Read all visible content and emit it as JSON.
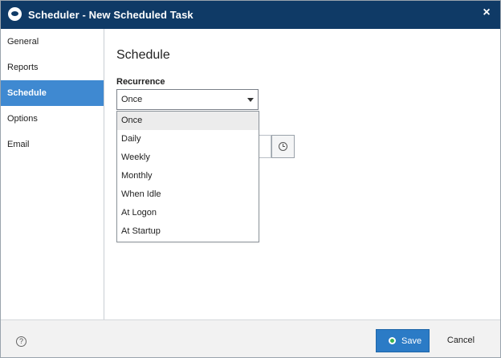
{
  "window": {
    "title": "Scheduler - New Scheduled Task",
    "close_glyph": "×"
  },
  "sidebar": {
    "items": [
      {
        "label": "General"
      },
      {
        "label": "Reports"
      },
      {
        "label": "Schedule"
      },
      {
        "label": "Options"
      },
      {
        "label": "Email"
      }
    ],
    "active_index": 2
  },
  "content": {
    "section_title": "Schedule",
    "recurrence": {
      "label": "Recurrence",
      "selected": "Once",
      "options": [
        "Once",
        "Daily",
        "Weekly",
        "Monthly",
        "When Idle",
        "At Logon",
        "At Startup"
      ],
      "hovered": "Once"
    }
  },
  "footer": {
    "help_glyph": "?",
    "save_label": "Save",
    "cancel_label": "Cancel"
  },
  "colors": {
    "titlebar": "#0f3a66",
    "sidebar_active": "#3f89d1",
    "primary_button": "#2b7bc6"
  },
  "icons": [
    "app-logo-icon",
    "close-icon",
    "dropdown-arrow-icon",
    "clock-icon",
    "help-icon",
    "save-icon"
  ]
}
